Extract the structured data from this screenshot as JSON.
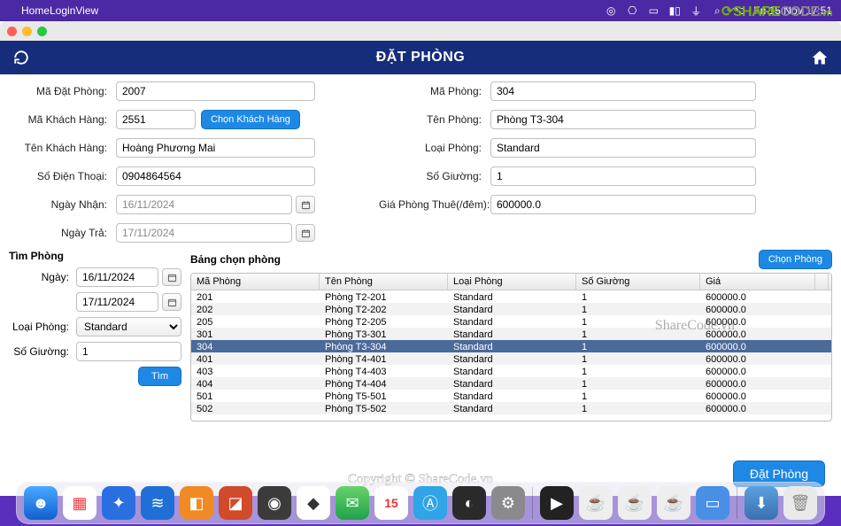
{
  "menubar": {
    "appname": "HomeLoginView",
    "clock": "Fri 15 Nov  17:51"
  },
  "header": {
    "title": "ĐẶT PHÒNG"
  },
  "form": {
    "booking_id_label": "Mã Đặt Phòng:",
    "booking_id": "2007",
    "cust_id_label": "Mã Khách Hàng:",
    "cust_id": "2551",
    "choose_cust_btn": "Chọn Khách Hàng",
    "cust_name_label": "Tên Khách Hàng:",
    "cust_name": "Hoàng Phương Mai",
    "phone_label": "Số Điện Thoại:",
    "phone": "0904864564",
    "checkin_label": "Ngày Nhận:",
    "checkin": "16/11/2024",
    "checkout_label": "Ngày Trả:",
    "checkout": "17/11/2024",
    "room_id_label": "Mã Phòng:",
    "room_id": "304",
    "room_name_label": "Tên Phòng:",
    "room_name": "Phòng T3-304",
    "room_type_label": "Loại Phòng:",
    "room_type": "Standard",
    "beds_label": "Số Giường:",
    "beds": "1",
    "price_label": "Giá Phòng Thuê(/đêm):",
    "price": "600000.0"
  },
  "find": {
    "title": "Tìm Phòng",
    "day_label": "Ngày:",
    "day_from": "16/11/2024",
    "day_to": "17/11/2024",
    "type_label": "Loại Phòng:",
    "type_value": "Standard",
    "beds_label": "Số Giường:",
    "beds_value": "1",
    "find_btn": "Tìm"
  },
  "table": {
    "title": "Bảng chọn phòng",
    "choose_btn": "Chọn Phòng",
    "cols": {
      "c0": "Mã Phòng",
      "c1": "Tên Phòng",
      "c2": "Loại Phòng",
      "c3": "Số Giường",
      "c4": "Giá"
    },
    "rows": [
      {
        "id": "201",
        "name": "Phòng T2-201",
        "type": "Standard",
        "beds": "1",
        "price": "600000.0",
        "sel": false
      },
      {
        "id": "202",
        "name": "Phòng T2-202",
        "type": "Standard",
        "beds": "1",
        "price": "600000.0",
        "sel": false
      },
      {
        "id": "205",
        "name": "Phòng T2-205",
        "type": "Standard",
        "beds": "1",
        "price": "600000.0",
        "sel": false
      },
      {
        "id": "301",
        "name": "Phòng T3-301",
        "type": "Standard",
        "beds": "1",
        "price": "600000.0",
        "sel": false
      },
      {
        "id": "304",
        "name": "Phòng T3-304",
        "type": "Standard",
        "beds": "1",
        "price": "600000.0",
        "sel": true
      },
      {
        "id": "401",
        "name": "Phòng T4-401",
        "type": "Standard",
        "beds": "1",
        "price": "600000.0",
        "sel": false
      },
      {
        "id": "403",
        "name": "Phòng T4-403",
        "type": "Standard",
        "beds": "1",
        "price": "600000.0",
        "sel": false
      },
      {
        "id": "404",
        "name": "Phòng T4-404",
        "type": "Standard",
        "beds": "1",
        "price": "600000.0",
        "sel": false
      },
      {
        "id": "501",
        "name": "Phòng T5-501",
        "type": "Standard",
        "beds": "1",
        "price": "600000.0",
        "sel": false
      },
      {
        "id": "502",
        "name": "Phòng T5-502",
        "type": "Standard",
        "beds": "1",
        "price": "600000.0",
        "sel": false
      }
    ]
  },
  "footer": {
    "submit": "Đặt Phòng"
  },
  "watermarks": {
    "side": "ShareCode.vn",
    "center": "Copyright © ShareCode.vn"
  }
}
